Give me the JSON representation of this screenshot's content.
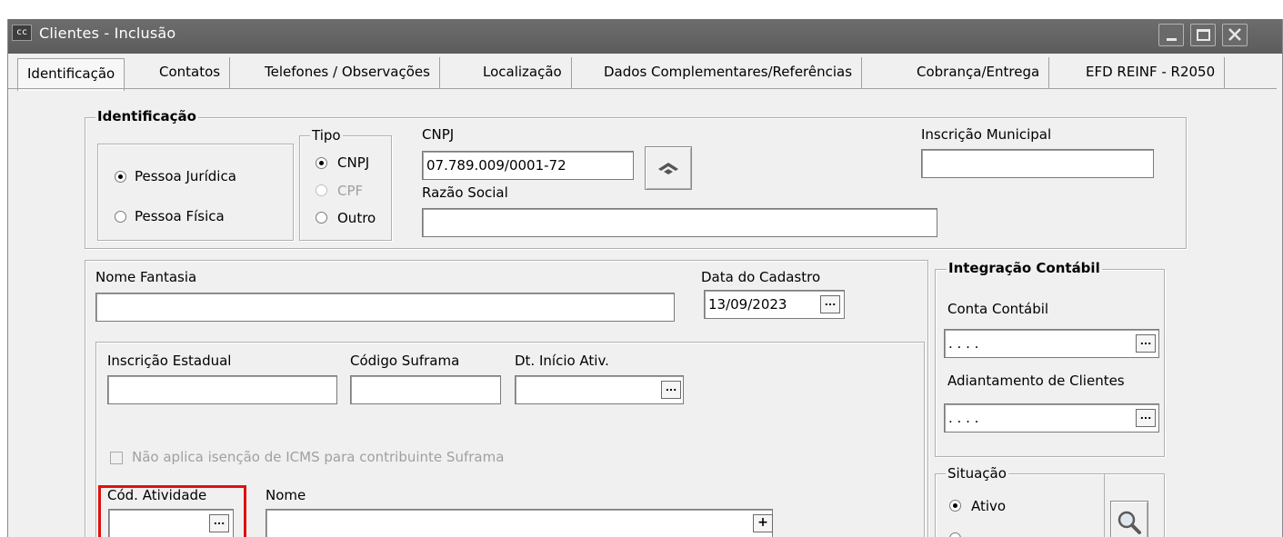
{
  "window": {
    "title": "Clientes - Inclusão",
    "icon_text": "cc",
    "controls": [
      "minimize-icon",
      "maximize-icon",
      "close-icon"
    ]
  },
  "tabs": [
    {
      "label": "Identificação",
      "active": true
    },
    {
      "label": "Contatos"
    },
    {
      "label": "Telefones / Observações"
    },
    {
      "label": "Localização"
    },
    {
      "label": "Dados Complementares/Referências"
    },
    {
      "label": "Cobrança/Entrega"
    },
    {
      "label": "EFD REINF - R2050"
    }
  ],
  "identificacao": {
    "legend": "Identificação",
    "pessoa_juridica": "Pessoa Jurídica",
    "pessoa_fisica": "Pessoa Física",
    "tipo_legend": "Tipo",
    "tipo_cnpj": "CNPJ",
    "tipo_cpf": "CPF",
    "tipo_outro": "Outro",
    "cnpj_label": "CNPJ",
    "cnpj_value": "07.789.009/0001-72",
    "razao_social_label": "Razão Social",
    "razao_social_value": "",
    "inscricao_municipal_label": "Inscrição Municipal",
    "inscricao_municipal_value": ""
  },
  "dados": {
    "nome_fantasia_label": "Nome Fantasia",
    "nome_fantasia_value": "",
    "data_cadastro_label": "Data do Cadastro",
    "data_cadastro_value": "13/09/2023",
    "inscricao_estadual_label": "Inscrição Estadual",
    "codigo_suframa_label": "Código Suframa",
    "dt_inicio_label": "Dt. Início Ativ.",
    "suframa_checkbox_label": "Não aplica isenção de ICMS para contribuinte Suframa",
    "cod_atividade_label": "Cód. Atividade",
    "nome_label": "Nome",
    "ellipsis": "...",
    "plus": "+"
  },
  "integracao": {
    "legend": "Integração Contábil",
    "conta_contabil_label": "Conta Contábil",
    "conta_contabil_value": ". . . .",
    "adiantamento_label": "Adiantamento de Clientes",
    "adiantamento_value": ". . . ."
  },
  "situacao": {
    "legend": "Situação",
    "ativo": "Ativo"
  }
}
